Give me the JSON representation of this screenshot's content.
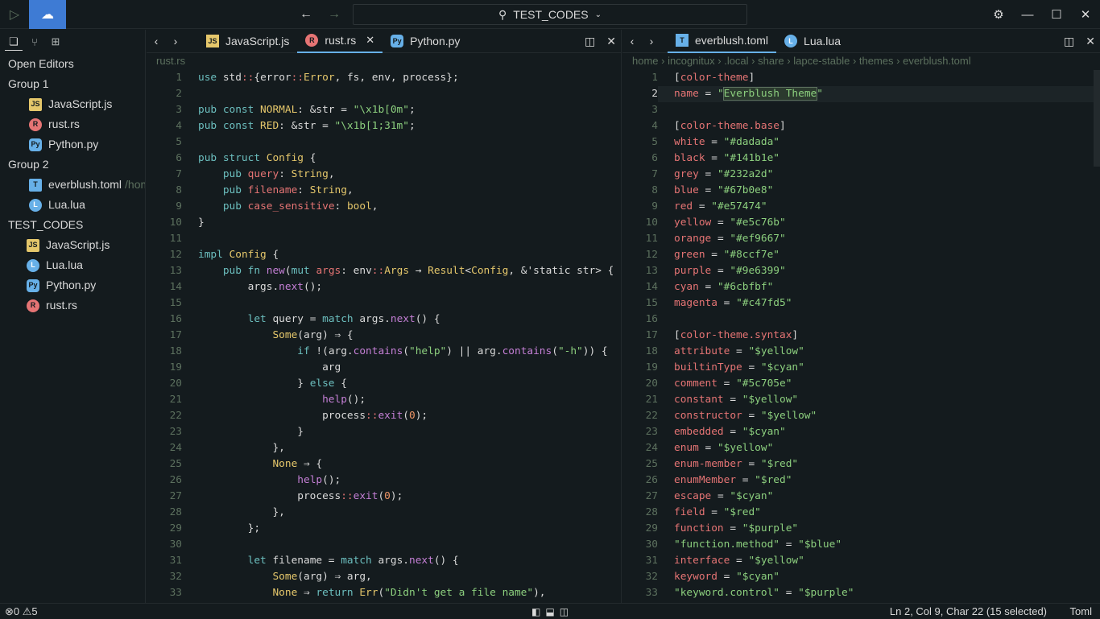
{
  "titlebar": {
    "search_label": "TEST_CODES",
    "icons": [
      "lapce-logo-icon",
      "remote-icon",
      "back-icon",
      "forward-icon",
      "search-icon",
      "chevron-down-icon",
      "gear-icon",
      "minimize-icon",
      "maximize-icon",
      "close-icon"
    ]
  },
  "sidebar": {
    "open_editors": "Open Editors",
    "group1": "Group 1",
    "group1_items": [
      {
        "label": "JavaScript.js",
        "icon": "JS"
      },
      {
        "label": "rust.rs",
        "icon": "R"
      },
      {
        "label": "Python.py",
        "icon": "Py"
      }
    ],
    "group2": "Group 2",
    "group2_items": [
      {
        "label": "everblush.toml",
        "hint": "/home",
        "icon": "T"
      },
      {
        "label": "Lua.lua",
        "icon": "L"
      }
    ],
    "workspace": "TEST_CODES",
    "workspace_items": [
      {
        "label": "JavaScript.js",
        "icon": "JS"
      },
      {
        "label": "Lua.lua",
        "icon": "L"
      },
      {
        "label": "Python.py",
        "icon": "Py"
      },
      {
        "label": "rust.rs",
        "icon": "R"
      }
    ]
  },
  "left_pane": {
    "tabs": [
      "JavaScript.js",
      "rust.rs",
      "Python.py"
    ],
    "breadcrumb": "rust.rs"
  },
  "right_pane": {
    "tabs": [
      "everblush.toml",
      "Lua.lua"
    ],
    "breadcrumb": [
      "home",
      "incognitux",
      ".local",
      "share",
      "lapce-stable",
      "themes",
      "everblush.toml"
    ]
  },
  "status": {
    "errors": "0",
    "warnings": "5",
    "position": "Ln 2, Col 9, Char 22 (15 selected)",
    "language": "Toml"
  },
  "rust_lines": [
    [
      [
        "kw",
        "use "
      ],
      [
        "",
        "std"
      ],
      [
        "op",
        "::"
      ],
      [
        "",
        "{error"
      ],
      [
        "op",
        "::"
      ],
      [
        "ty",
        "Error"
      ],
      [
        "",
        ", fs, env, process};"
      ]
    ],
    [],
    [
      [
        "kw",
        "pub const "
      ],
      [
        "ty",
        "NORMAL"
      ],
      [
        "",
        ": &str = "
      ],
      [
        "st",
        "\"\\x1b[0m\""
      ],
      [
        "",
        ";"
      ]
    ],
    [
      [
        "kw",
        "pub const "
      ],
      [
        "ty",
        "RED"
      ],
      [
        "",
        ": &str = "
      ],
      [
        "st",
        "\"\\x1b[1;31m\""
      ],
      [
        "",
        ";"
      ]
    ],
    [],
    [
      [
        "kw",
        "pub struct "
      ],
      [
        "ty",
        "Config"
      ],
      [
        "",
        " {"
      ]
    ],
    [
      [
        "",
        "    "
      ],
      [
        "kw",
        "pub "
      ],
      [
        "va",
        "query"
      ],
      [
        "",
        ": "
      ],
      [
        "ty",
        "String"
      ],
      [
        "",
        ","
      ]
    ],
    [
      [
        "",
        "    "
      ],
      [
        "kw",
        "pub "
      ],
      [
        "va",
        "filename"
      ],
      [
        "",
        ": "
      ],
      [
        "ty",
        "String"
      ],
      [
        "",
        ","
      ]
    ],
    [
      [
        "",
        "    "
      ],
      [
        "kw",
        "pub "
      ],
      [
        "va",
        "case_sensitive"
      ],
      [
        "",
        ": "
      ],
      [
        "ty",
        "bool"
      ],
      [
        "",
        ","
      ]
    ],
    [
      [
        "",
        "}"
      ]
    ],
    [],
    [
      [
        "kw",
        "impl "
      ],
      [
        "ty",
        "Config"
      ],
      [
        "",
        " {"
      ]
    ],
    [
      [
        "",
        "    "
      ],
      [
        "kw",
        "pub fn "
      ],
      [
        "fn",
        "new"
      ],
      [
        "",
        "("
      ],
      [
        "kw",
        "mut "
      ],
      [
        "va",
        "args"
      ],
      [
        "",
        ": env"
      ],
      [
        "op",
        "::"
      ],
      [
        "ty",
        "Args"
      ],
      [
        "",
        " → "
      ],
      [
        "ty",
        "Result"
      ],
      [
        "",
        "<"
      ],
      [
        "ty",
        "Config"
      ],
      [
        "",
        ", &'static str> {"
      ]
    ],
    [
      [
        "",
        "        args."
      ],
      [
        "fn",
        "next"
      ],
      [
        "",
        "();"
      ]
    ],
    [],
    [
      [
        "",
        "        "
      ],
      [
        "kw",
        "let "
      ],
      [
        "",
        "query = "
      ],
      [
        "kw",
        "match "
      ],
      [
        "",
        "args."
      ],
      [
        "fn",
        "next"
      ],
      [
        "",
        "() {"
      ]
    ],
    [
      [
        "",
        "            "
      ],
      [
        "ty",
        "Some"
      ],
      [
        "",
        "(arg) ⇒ {"
      ]
    ],
    [
      [
        "",
        "                "
      ],
      [
        "kw",
        "if "
      ],
      [
        "",
        "!(arg."
      ],
      [
        "fn",
        "contains"
      ],
      [
        "",
        "("
      ],
      [
        "st",
        "\"help\""
      ],
      [
        "",
        ") || arg."
      ],
      [
        "fn",
        "contains"
      ],
      [
        "",
        "("
      ],
      [
        "st",
        "\"-h\""
      ],
      [
        "",
        ")) {"
      ]
    ],
    [
      [
        "",
        "                    arg"
      ]
    ],
    [
      [
        "",
        "                } "
      ],
      [
        "kw",
        "else "
      ],
      [
        "",
        "{"
      ]
    ],
    [
      [
        "",
        "                    "
      ],
      [
        "fn",
        "help"
      ],
      [
        "",
        "();"
      ]
    ],
    [
      [
        "",
        "                    process"
      ],
      [
        "op",
        "::"
      ],
      [
        "fn",
        "exit"
      ],
      [
        "",
        "("
      ],
      [
        "nu",
        "0"
      ],
      [
        "",
        ");"
      ]
    ],
    [
      [
        "",
        "                }"
      ]
    ],
    [
      [
        "",
        "            },"
      ]
    ],
    [
      [
        "",
        "            "
      ],
      [
        "ty",
        "None"
      ],
      [
        "",
        " ⇒ {"
      ]
    ],
    [
      [
        "",
        "                "
      ],
      [
        "fn",
        "help"
      ],
      [
        "",
        "();"
      ]
    ],
    [
      [
        "",
        "                process"
      ],
      [
        "op",
        "::"
      ],
      [
        "fn",
        "exit"
      ],
      [
        "",
        "("
      ],
      [
        "nu",
        "0"
      ],
      [
        "",
        ");"
      ]
    ],
    [
      [
        "",
        "            },"
      ]
    ],
    [
      [
        "",
        "        };"
      ]
    ],
    [],
    [
      [
        "",
        "        "
      ],
      [
        "kw",
        "let "
      ],
      [
        "",
        "filename = "
      ],
      [
        "kw",
        "match "
      ],
      [
        "",
        "args."
      ],
      [
        "fn",
        "next"
      ],
      [
        "",
        "() {"
      ]
    ],
    [
      [
        "",
        "            "
      ],
      [
        "ty",
        "Some"
      ],
      [
        "",
        "(arg) ⇒ arg,"
      ]
    ],
    [
      [
        "",
        "            "
      ],
      [
        "ty",
        "None"
      ],
      [
        "",
        " ⇒ "
      ],
      [
        "kw",
        "return "
      ],
      [
        "ty",
        "Err"
      ],
      [
        "",
        "("
      ],
      [
        "st",
        "\"Didn't get a file name\""
      ],
      [
        "",
        "),"
      ]
    ]
  ],
  "toml_lines": [
    [
      [
        "",
        "["
      ],
      [
        "va",
        "color-theme"
      ],
      [
        "",
        "]"
      ]
    ],
    [
      [
        "va",
        "name"
      ],
      [
        "",
        " = "
      ],
      [
        "st",
        "\""
      ],
      [
        "sel",
        "Everblush Theme"
      ],
      [
        "st",
        "\""
      ]
    ],
    [],
    [
      [
        "",
        "["
      ],
      [
        "va",
        "color-theme.base"
      ],
      [
        "",
        "]"
      ]
    ],
    [
      [
        "va",
        "white"
      ],
      [
        "",
        " = "
      ],
      [
        "st",
        "\"#dadada\""
      ]
    ],
    [
      [
        "va",
        "black"
      ],
      [
        "",
        " = "
      ],
      [
        "st",
        "\"#141b1e\""
      ]
    ],
    [
      [
        "va",
        "grey"
      ],
      [
        "",
        " = "
      ],
      [
        "st",
        "\"#232a2d\""
      ]
    ],
    [
      [
        "va",
        "blue"
      ],
      [
        "",
        " = "
      ],
      [
        "st",
        "\"#67b0e8\""
      ]
    ],
    [
      [
        "va",
        "red"
      ],
      [
        "",
        " = "
      ],
      [
        "st",
        "\"#e57474\""
      ]
    ],
    [
      [
        "va",
        "yellow"
      ],
      [
        "",
        " = "
      ],
      [
        "st",
        "\"#e5c76b\""
      ]
    ],
    [
      [
        "va",
        "orange"
      ],
      [
        "",
        " = "
      ],
      [
        "st",
        "\"#ef9667\""
      ]
    ],
    [
      [
        "va",
        "green"
      ],
      [
        "",
        " = "
      ],
      [
        "st",
        "\"#8ccf7e\""
      ]
    ],
    [
      [
        "va",
        "purple"
      ],
      [
        "",
        " = "
      ],
      [
        "st",
        "\"#9e6399\""
      ]
    ],
    [
      [
        "va",
        "cyan"
      ],
      [
        "",
        " = "
      ],
      [
        "st",
        "\"#6cbfbf\""
      ]
    ],
    [
      [
        "va",
        "magenta"
      ],
      [
        "",
        " = "
      ],
      [
        "st",
        "\"#c47fd5\""
      ]
    ],
    [],
    [
      [
        "",
        "["
      ],
      [
        "va",
        "color-theme.syntax"
      ],
      [
        "",
        "]"
      ]
    ],
    [
      [
        "va",
        "attribute"
      ],
      [
        "",
        " = "
      ],
      [
        "st",
        "\"$yellow\""
      ]
    ],
    [
      [
        "va",
        "builtinType"
      ],
      [
        "",
        " = "
      ],
      [
        "st",
        "\"$cyan\""
      ]
    ],
    [
      [
        "va",
        "comment"
      ],
      [
        "",
        " = "
      ],
      [
        "st",
        "\"#5c705e\""
      ]
    ],
    [
      [
        "va",
        "constant"
      ],
      [
        "",
        " = "
      ],
      [
        "st",
        "\"$yellow\""
      ]
    ],
    [
      [
        "va",
        "constructor"
      ],
      [
        "",
        " = "
      ],
      [
        "st",
        "\"$yellow\""
      ]
    ],
    [
      [
        "va",
        "embedded"
      ],
      [
        "",
        " = "
      ],
      [
        "st",
        "\"$cyan\""
      ]
    ],
    [
      [
        "va",
        "enum"
      ],
      [
        "",
        " = "
      ],
      [
        "st",
        "\"$yellow\""
      ]
    ],
    [
      [
        "va",
        "enum-member"
      ],
      [
        "",
        " = "
      ],
      [
        "st",
        "\"$red\""
      ]
    ],
    [
      [
        "va",
        "enumMember"
      ],
      [
        "",
        " = "
      ],
      [
        "st",
        "\"$red\""
      ]
    ],
    [
      [
        "va",
        "escape"
      ],
      [
        "",
        " = "
      ],
      [
        "st",
        "\"$cyan\""
      ]
    ],
    [
      [
        "va",
        "field"
      ],
      [
        "",
        " = "
      ],
      [
        "st",
        "\"$red\""
      ]
    ],
    [
      [
        "va",
        "function"
      ],
      [
        "",
        " = "
      ],
      [
        "st",
        "\"$purple\""
      ]
    ],
    [
      [
        "st",
        "\"function.method\""
      ],
      [
        "",
        " = "
      ],
      [
        "st",
        "\"$blue\""
      ]
    ],
    [
      [
        "va",
        "interface"
      ],
      [
        "",
        " = "
      ],
      [
        "st",
        "\"$yellow\""
      ]
    ],
    [
      [
        "va",
        "keyword"
      ],
      [
        "",
        " = "
      ],
      [
        "st",
        "\"$cyan\""
      ]
    ],
    [
      [
        "st",
        "\"keyword.control\""
      ],
      [
        "",
        " = "
      ],
      [
        "st",
        "\"$purple\""
      ]
    ]
  ],
  "colors": {
    "bg": "#141b1e",
    "fg": "#dadada",
    "accent": "#67b0e8",
    "comment": "#5c705e"
  }
}
